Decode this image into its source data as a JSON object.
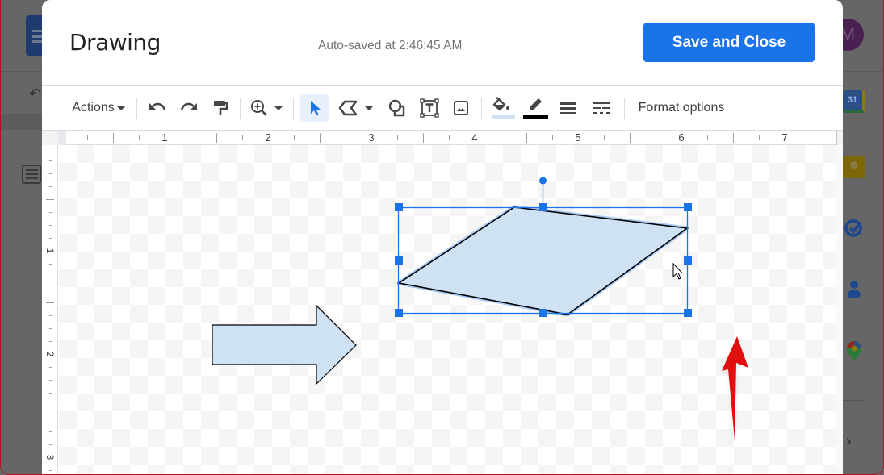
{
  "background": {
    "avatar_initial": "M",
    "side_apps": [
      {
        "name": "calendar",
        "label": "31"
      },
      {
        "name": "keep"
      },
      {
        "name": "tasks"
      },
      {
        "name": "contacts"
      },
      {
        "name": "maps"
      }
    ],
    "expand_glyph": "›"
  },
  "dialog": {
    "title": "Drawing",
    "autosave_text": "Auto-saved at 2:46:45 AM",
    "save_button_label": "Save and Close"
  },
  "toolbar": {
    "actions_label": "Actions",
    "format_options_label": "Format options",
    "fill_color": "#cfe2f3",
    "line_color": "#000000",
    "tools": [
      {
        "icon": "undo-icon"
      },
      {
        "icon": "redo-icon"
      },
      {
        "icon": "paint-format-icon"
      },
      {
        "icon": "zoom-icon"
      },
      {
        "icon": "select-icon",
        "active": true
      },
      {
        "icon": "line-icon"
      },
      {
        "icon": "shape-icon"
      },
      {
        "icon": "text-box-icon"
      },
      {
        "icon": "image-icon"
      },
      {
        "icon": "fill-color-icon"
      },
      {
        "icon": "border-color-icon"
      },
      {
        "icon": "border-weight-icon"
      },
      {
        "icon": "border-dash-icon"
      }
    ]
  },
  "ruler": {
    "horizontal_labels": [
      "1",
      "2",
      "3",
      "4",
      "5",
      "6",
      "7"
    ],
    "vertical_labels": [
      "1",
      "2",
      "3"
    ]
  },
  "canvas": {
    "shapes": [
      {
        "type": "parallelogram",
        "fill": "#cfe2f3",
        "stroke": "#000000",
        "selected": true
      },
      {
        "type": "right-arrow",
        "fill": "#cfe2f3",
        "stroke": "#000000",
        "selected": false
      }
    ],
    "selection_color": "#1a73e8",
    "annotation_arrow_color": "#e01010"
  }
}
